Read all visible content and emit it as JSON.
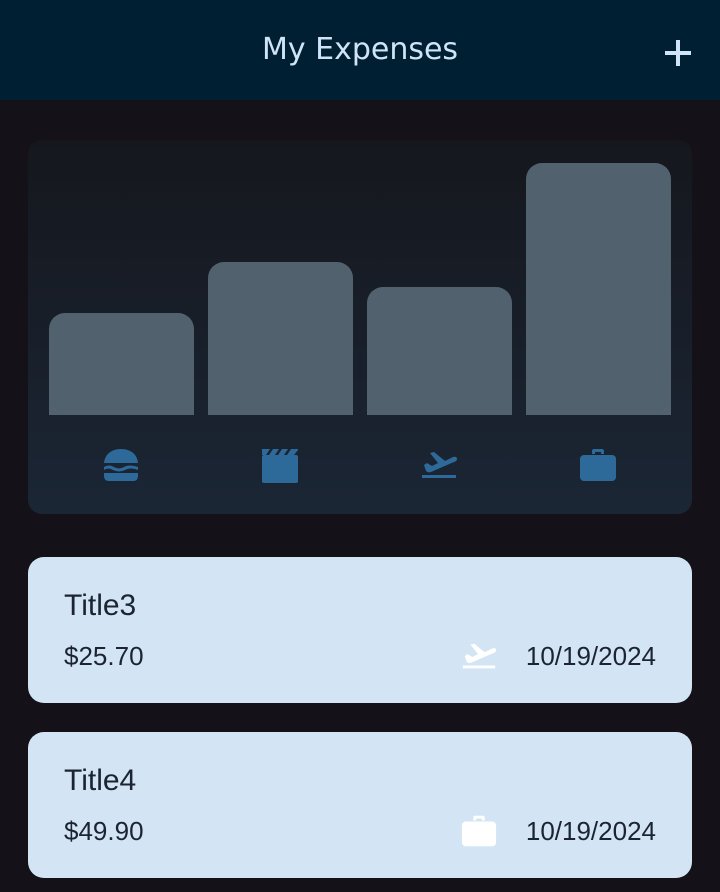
{
  "header": {
    "title": "My Expenses",
    "add_icon": "plus-icon"
  },
  "colors": {
    "app_bar": "#001f33",
    "background": "#141218",
    "bar": "#52616e",
    "category_icon": "#2e6a99",
    "card": "#d3e4f5"
  },
  "chart_data": {
    "type": "bar",
    "categories": [
      "food",
      "leisure",
      "travel",
      "work"
    ],
    "category_icons": [
      "hamburger-icon",
      "movie-clapper-icon",
      "flight-takeoff-icon",
      "briefcase-icon"
    ],
    "values": [
      0.4,
      0.6,
      0.5,
      0.99
    ],
    "ylim": [
      0,
      1
    ],
    "grid": false
  },
  "expenses": [
    {
      "title": "Title3",
      "amount": "$25.70",
      "date": "10/19/2024",
      "category_icon": "flight-takeoff-icon"
    },
    {
      "title": "Title4",
      "amount": "$49.90",
      "date": "10/19/2024",
      "category_icon": "briefcase-icon"
    }
  ]
}
